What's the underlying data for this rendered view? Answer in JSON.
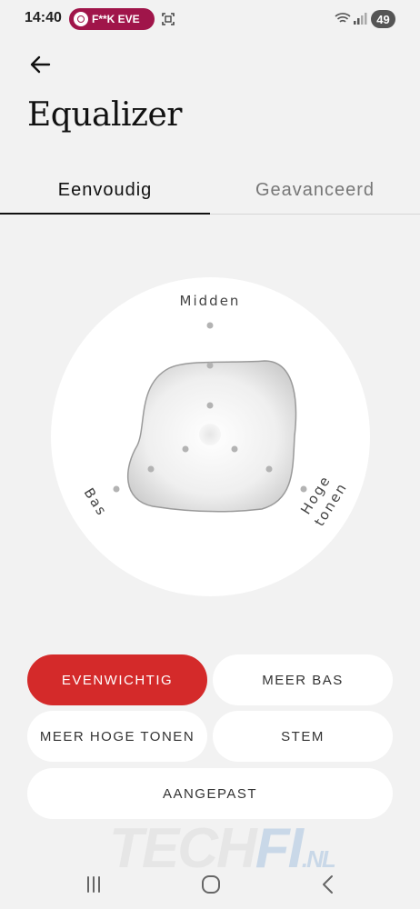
{
  "status_bar": {
    "time": "14:40",
    "notification_pill": "F**K EVE",
    "battery": "49"
  },
  "header": {
    "title": "Equalizer"
  },
  "tabs": [
    {
      "label": "Eenvoudig",
      "active": true
    },
    {
      "label": "Geavanceerd",
      "active": false
    }
  ],
  "equalizer": {
    "labels": {
      "mid": "Midden",
      "bass": "Bas",
      "treble_line1": "Hoge",
      "treble_line2": "tonen"
    },
    "levels": {
      "mid": 0.5,
      "bass": 0.5,
      "treble": 0.5
    }
  },
  "presets": [
    {
      "label": "EVENWICHTIG",
      "selected": true
    },
    {
      "label": "MEER BAS",
      "selected": false
    },
    {
      "label": "MEER HOGE TONEN",
      "selected": false
    },
    {
      "label": "STEM",
      "selected": false
    },
    {
      "label": "AANGEPAST",
      "selected": false
    }
  ],
  "watermark": {
    "part1": "TECH",
    "part2": "FI",
    "part3": ".NL"
  },
  "colors": {
    "accent": "#d42a2a",
    "pill": "#a0154a",
    "background": "#f2f2f2"
  },
  "nav_bar": {
    "icons": [
      "recent-apps-icon",
      "home-icon",
      "back-icon"
    ]
  }
}
